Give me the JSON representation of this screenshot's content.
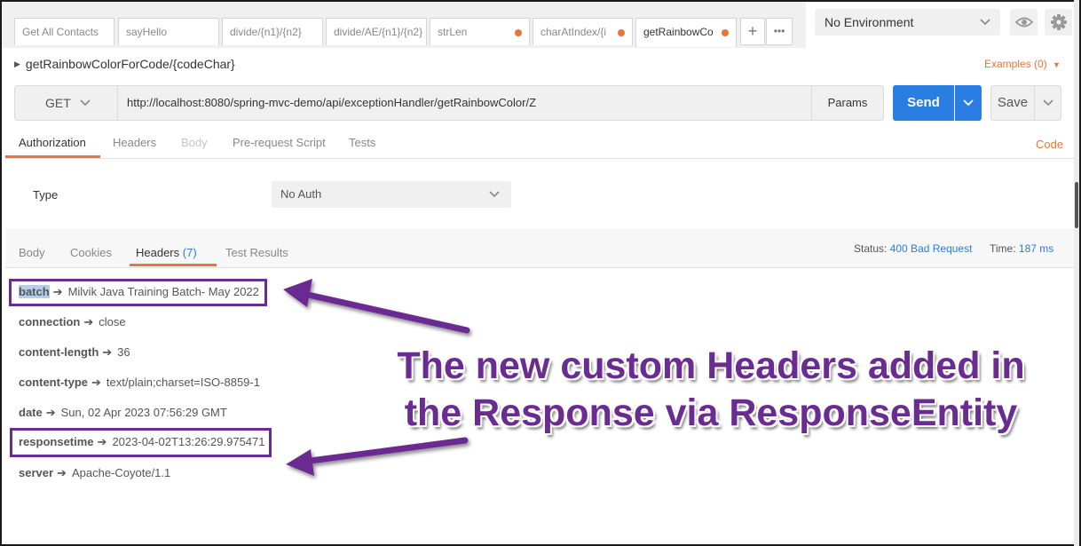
{
  "tabs": [
    {
      "label": "Get All Contacts",
      "dirty": false
    },
    {
      "label": "sayHello",
      "dirty": false
    },
    {
      "label": "divide/{n1}/{n2}",
      "dirty": false
    },
    {
      "label": "divide/AE/{n1}/{n2}",
      "dirty": false
    },
    {
      "label": "strLen",
      "dirty": true
    },
    {
      "label": "charAtIndex/{i",
      "dirty": true
    },
    {
      "label": "getRainbowCo",
      "dirty": true,
      "active": true
    }
  ],
  "tab_actions": {
    "add": "+",
    "more": "•••"
  },
  "environment": {
    "selected": "No Environment"
  },
  "request": {
    "name": "getRainbowColorForCode/{codeChar}",
    "examples": "Examples (0)",
    "method": "GET",
    "url": "http://localhost:8080/spring-mvc-demo/api/exceptionHandler/getRainbowColor/Z",
    "params_label": "Params",
    "send_label": "Send",
    "save_label": "Save"
  },
  "request_tabs": [
    {
      "label": "Authorization",
      "state": "active"
    },
    {
      "label": "Headers",
      "state": "normal"
    },
    {
      "label": "Body",
      "state": "disabled"
    },
    {
      "label": "Pre-request Script",
      "state": "normal"
    },
    {
      "label": "Tests",
      "state": "normal"
    }
  ],
  "code_link": "Code",
  "auth": {
    "type_label": "Type",
    "type_value": "No Auth"
  },
  "response": {
    "tabs": {
      "body": "Body",
      "cookies": "Cookies",
      "headers": "Headers",
      "headers_count": "(7)",
      "test_results": "Test Results"
    },
    "status_label": "Status:",
    "status_value": "400 Bad Request",
    "time_label": "Time:",
    "time_value": "187 ms",
    "headers": [
      {
        "key": "batch",
        "value": "Milvik Java Training Batch- May 2022"
      },
      {
        "key": "connection",
        "value": "close"
      },
      {
        "key": "content-length",
        "value": "36"
      },
      {
        "key": "content-type",
        "value": "text/plain;charset=ISO-8859-1"
      },
      {
        "key": "date",
        "value": "Sun, 02 Apr 2023 07:56:29 GMT"
      },
      {
        "key": "responsetime",
        "value": "2023-04-02T13:26:29.975471"
      },
      {
        "key": "server",
        "value": "Apache-Coyote/1.1"
      }
    ],
    "arrow_glyph": "➔"
  },
  "annotation": {
    "line1": "The new custom Headers added in",
    "line2": "the Response via ResponseEntity",
    "color": "#6a2c91"
  },
  "colors": {
    "accent": "#e8763a",
    "primary": "#2a7de1",
    "highlight": "#6a2c91"
  }
}
